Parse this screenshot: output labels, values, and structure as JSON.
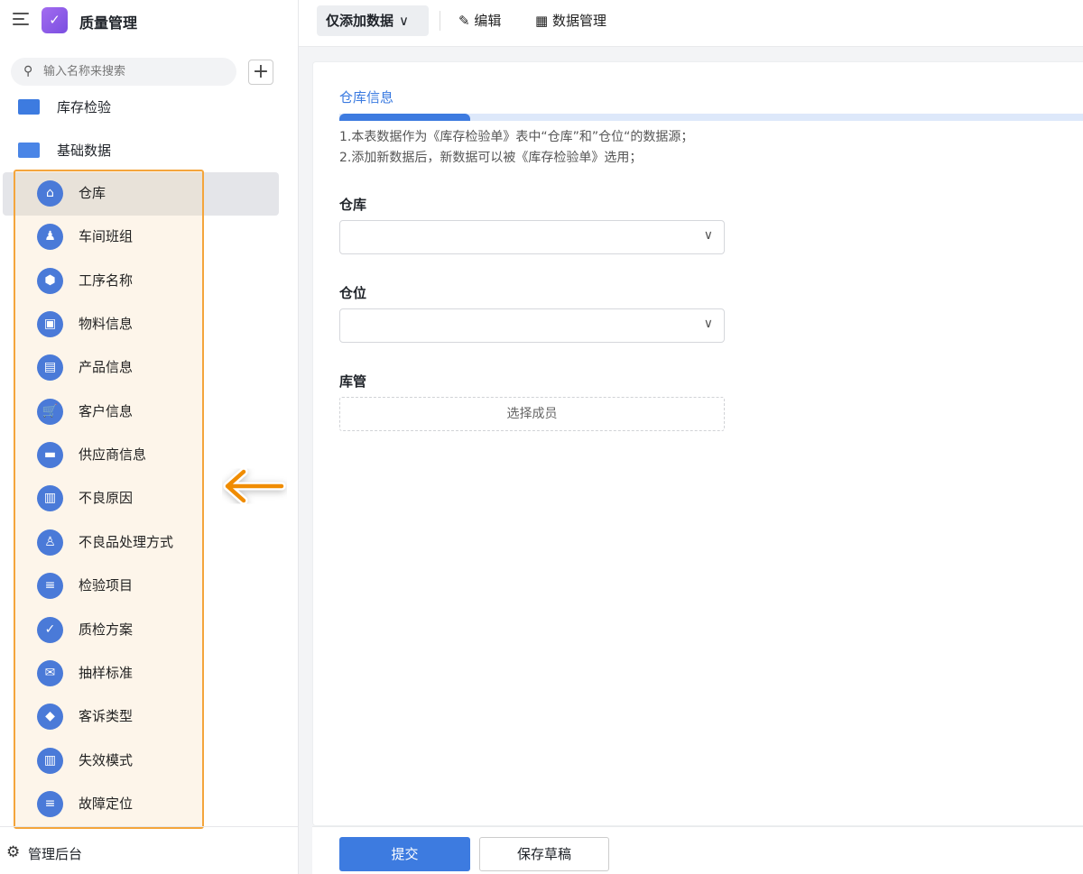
{
  "app": {
    "title": "质量管理",
    "logo_icon": "clipboard-check-icon"
  },
  "search": {
    "placeholder": "输入名称来搜索"
  },
  "folders": [
    {
      "label": "库存检验"
    },
    {
      "label": "基础数据"
    }
  ],
  "nav": [
    {
      "label": "仓库",
      "icon": "home-icon",
      "glyph": "⌂"
    },
    {
      "label": "车间班组",
      "icon": "person-icon",
      "glyph": "♟"
    },
    {
      "label": "工序名称",
      "icon": "gear-nut-icon",
      "glyph": "⬢"
    },
    {
      "label": "物料信息",
      "icon": "box-icon",
      "glyph": "▣"
    },
    {
      "label": "产品信息",
      "icon": "bag-icon",
      "glyph": "▤"
    },
    {
      "label": "客户信息",
      "icon": "cart-icon",
      "glyph": "🛒"
    },
    {
      "label": "供应商信息",
      "icon": "truck-icon",
      "glyph": "▬"
    },
    {
      "label": "不良原因",
      "icon": "chart-icon",
      "glyph": "▥"
    },
    {
      "label": "不良品处理方式",
      "icon": "org-chart-icon",
      "glyph": "♙"
    },
    {
      "label": "检验项目",
      "icon": "document-icon",
      "glyph": "≡"
    },
    {
      "label": "质检方案",
      "icon": "shield-check-icon",
      "glyph": "✓"
    },
    {
      "label": "抽样标准",
      "icon": "mail-open-icon",
      "glyph": "✉"
    },
    {
      "label": "客诉类型",
      "icon": "tag-icon",
      "glyph": "◆"
    },
    {
      "label": "失效模式",
      "icon": "chart-icon",
      "glyph": "▥"
    },
    {
      "label": "故障定位",
      "icon": "document-icon",
      "glyph": "≡"
    }
  ],
  "sidebar_footer": {
    "label": "管理后台"
  },
  "toolbar": {
    "mode": "仅添加数据",
    "edit": "编辑",
    "data_manage": "数据管理"
  },
  "form": {
    "section_title": "仓库信息",
    "progress": 0.175,
    "desc": [
      "1.本表数据作为《库存检验单》表中“仓库”和”仓位“的数据源；",
      "2.添加新数据后，新数据可以被《库存检验单》选用；"
    ],
    "fields": [
      {
        "label": "仓库",
        "value": ""
      },
      {
        "label": "仓位",
        "value": ""
      }
    ],
    "member_label": "库管",
    "member_placeholder": "选择成员",
    "submit": "提交",
    "save_draft": "保存草稿"
  },
  "colors": {
    "accent": "#3d7be0",
    "highlight_border": "#f4a53c",
    "arrow": "#f08c00"
  }
}
